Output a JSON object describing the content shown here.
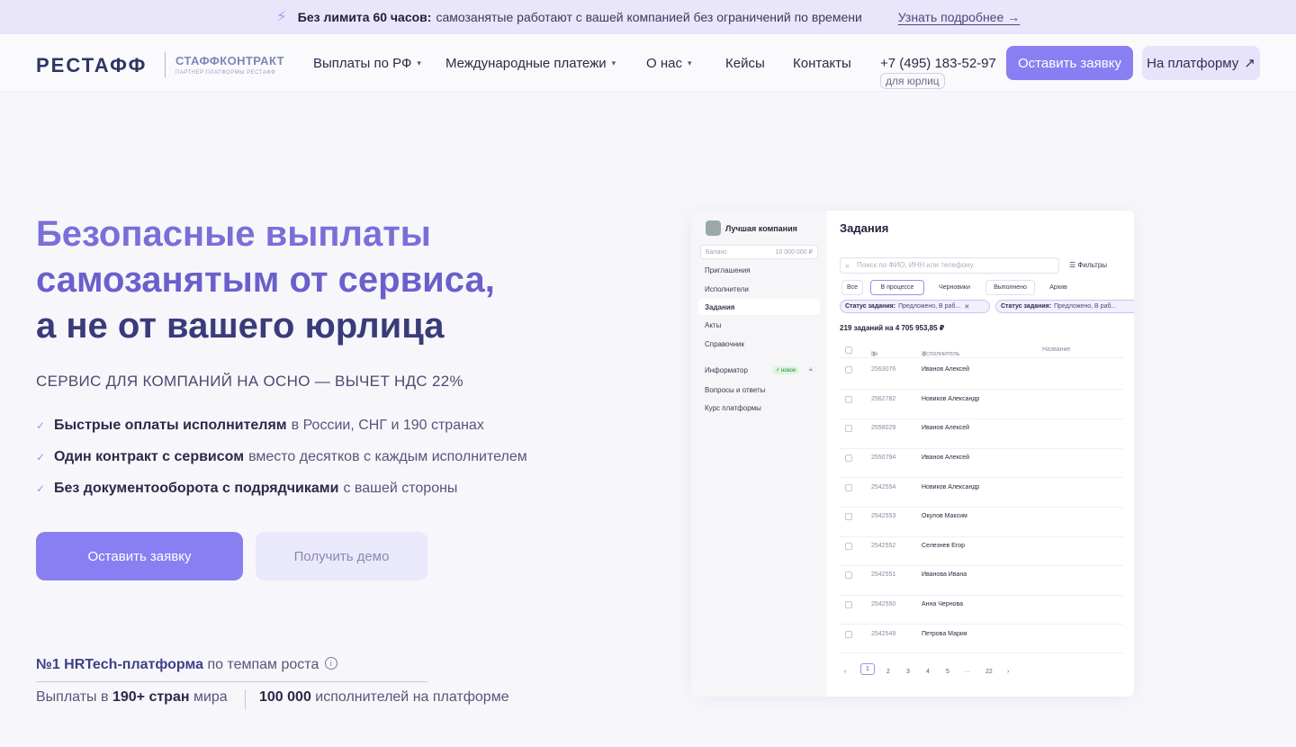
{
  "topbar": {
    "bold": "Без лимита 60 часов:",
    "text": "самозанятые работают с вашей компанией без ограничений по времени",
    "link": "Узнать подробнее →"
  },
  "header": {
    "logo": "РЕСТАФФ",
    "sublogo": "СТАФФКОНТРАКТ",
    "sublogo_caption": "ПАРТНЕР ПЛАТФОРМЫ РЕСТАФФ",
    "nav": [
      "Выплаты по РФ",
      "Международные платежи",
      "О нас",
      "Кейсы",
      "Контакты"
    ],
    "phone": "+7 (495) 183-52-97",
    "phone_tag": "для юрлиц",
    "apply_button": "Оставить заявку",
    "platform_button": "На платформу"
  },
  "hero": {
    "title_line1": "Безопасные выплаты",
    "title_line2": "самозанятым от сервиса,",
    "title_line3": "а не от вашего юрлица",
    "subtitle": "СЕРВИС ДЛЯ КОМПАНИЙ НА ОСНО — ВЫЧЕТ НДС 22%",
    "benefits": [
      {
        "bold": "Быстрые оплаты исполнителям",
        "rest": "в России, СНГ и 190 странах"
      },
      {
        "bold": "Один контракт с сервисом",
        "rest": "вместо десятков с каждым исполнителем"
      },
      {
        "bold": "Без документооборота с подрядчиками",
        "rest": "с вашей стороны"
      }
    ],
    "apply_button": "Оставить заявку",
    "demo_button": "Получить демо",
    "rank_bold": "№1 HRTech-платформа",
    "rank_rest": "по темпам роста",
    "stat1_pre": "Выплаты в",
    "stat1_bold": "190+ стран",
    "stat1_post": "мира",
    "stat2_bold": "100 000",
    "stat2_post": "исполнителей на платформе"
  },
  "mockup": {
    "company": "Лучшая компания",
    "balance_label": "Баланс",
    "balance_value": "10 000 000 ₽",
    "sidebar": [
      "Приглашения",
      "Исполнители",
      "Задания",
      "Акты",
      "Справочник",
      "Информатор",
      "Вопросы и ответы",
      "Курс платформы"
    ],
    "new_badge": "новое",
    "title": "Задания",
    "search_placeholder": "Поиск по ФИО, ИНН или телефону",
    "filters": "Фильтры",
    "tabs": [
      "Все",
      "В процессе",
      "Черновики",
      "Выполнено",
      "Архив"
    ],
    "chips": [
      {
        "label": "Статус задания:",
        "value": "Предложено, В раб..."
      },
      {
        "label": "Статус задания:",
        "value": "Предложено, В раб..."
      }
    ],
    "count": "219 заданий на 4 705 953,85 ₽",
    "columns": [
      "№",
      "Исполнитель",
      "Название"
    ],
    "rows": [
      {
        "num": "2563076",
        "name": "Иванов Алексей"
      },
      {
        "num": "2562782",
        "name": "Новиков Александр"
      },
      {
        "num": "2558029",
        "name": "Иванов Алексей"
      },
      {
        "num": "2550794",
        "name": "Иванов Алексей"
      },
      {
        "num": "2542554",
        "name": "Новиков Александр"
      },
      {
        "num": "2542553",
        "name": "Окулов Максим"
      },
      {
        "num": "2542552",
        "name": "Селезнев Егор"
      },
      {
        "num": "2542551",
        "name": "Иванова Ивана"
      },
      {
        "num": "2542550",
        "name": "Анна Чернова"
      },
      {
        "num": "2542549",
        "name": "Петрова Мария"
      }
    ],
    "pagination": [
      "‹",
      "1",
      "2",
      "3",
      "4",
      "5",
      "···",
      "22",
      "›"
    ]
  }
}
